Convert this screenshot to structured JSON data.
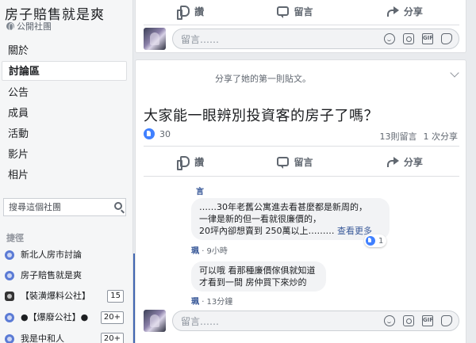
{
  "group": {
    "name": "房子賠售就是爽",
    "type": "公開社團"
  },
  "nav": {
    "items": [
      {
        "label": "關於"
      },
      {
        "label": "討論區"
      },
      {
        "label": "公告"
      },
      {
        "label": "成員"
      },
      {
        "label": "活動"
      },
      {
        "label": "影片"
      },
      {
        "label": "相片"
      }
    ],
    "active": "討論區"
  },
  "sidebar_search": {
    "placeholder": "搜尋這個社團"
  },
  "shortcuts": {
    "heading": "捷徑",
    "items": [
      {
        "label": "新北人房市討論",
        "badge": ""
      },
      {
        "label": "房子賠售就是爽",
        "badge": ""
      },
      {
        "label": "【裝潢爆料公社】",
        "badge": "15"
      },
      {
        "label": "●【爆廢公社】●",
        "badge": "20+"
      },
      {
        "label": "我是中和人",
        "badge": "20+"
      }
    ]
  },
  "actions": {
    "like": "讚",
    "comment": "留言",
    "share": "分享"
  },
  "comment_input": {
    "placeholder": "留言……"
  },
  "post": {
    "shared_text": "分享了她的第一則貼文。",
    "title": "大家能一眼辨別投資客的房子了嗎？",
    "like_count": "30",
    "comments_count": "13則留言",
    "shares_count": "1 次分享"
  },
  "comments": [
    {
      "author": "言",
      "text_lines": [
        "……30年老舊公寓進去看甚麼都是新周的，",
        "一律是新的但一看就很廉價的，",
        "20坪內卻想賣到 250萬以上………"
      ],
      "see_more": "查看更多",
      "reaction_count": "1",
      "meta_author": "珮",
      "time": "9小時"
    },
    {
      "author": "",
      "text_lines": [
        "可以哦 看那種廉價傢俱就知道",
        "才看到一間 房仲買下來炒的"
      ],
      "see_more": "",
      "reaction_count": "",
      "meta_author": "珮",
      "time": "13分鐘"
    }
  ],
  "colors": {
    "link": "#385898",
    "like_blue": "#4080ff",
    "background": "#e9ebee"
  }
}
